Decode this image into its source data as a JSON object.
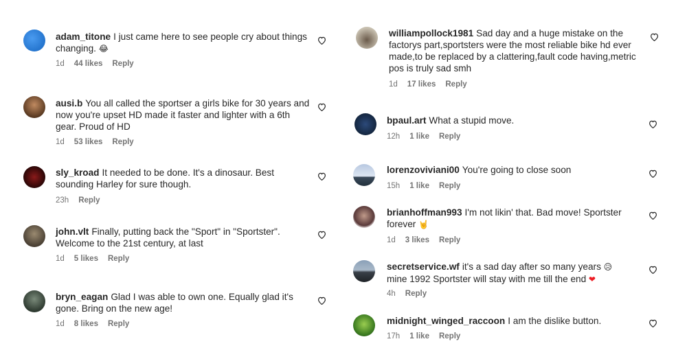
{
  "comments_left": [
    {
      "user": "adam_titone",
      "text": "I just came here to see people cry about things changing.",
      "emoji": "😂",
      "time": "1d",
      "likes": "44 likes",
      "reply": "Reply"
    },
    {
      "user": "ausi.b",
      "text": "You all called the sportser a girls bike for 30 years and now you're upset HD made it faster and lighter with a 6th gear. Proud of HD",
      "time": "1d",
      "likes": "53 likes",
      "reply": "Reply"
    },
    {
      "user": "sly_kroad",
      "text": "It needed to be done. It's a dinosaur. Best sounding Harley for sure though.",
      "time": "23h",
      "reply": "Reply"
    },
    {
      "user": "john.vlt",
      "text": "Finally, putting back the \"Sport\" in \"Sportster\". Welcome to the 21st century, at last",
      "time": "1d",
      "likes": "5 likes",
      "reply": "Reply"
    },
    {
      "user": "bryn_eagan",
      "text": "Glad I was able to own one. Equally glad it's gone. Bring on the new age!",
      "time": "1d",
      "likes": "8 likes",
      "reply": "Reply"
    }
  ],
  "comments_right": [
    {
      "user": "williampollock1981",
      "text": "Sad day and a huge mistake on the factorys part,sportsters were the most reliable bike hd ever made,to be replaced by a clattering,fault code having,metric pos is truly sad smh",
      "time": "1d",
      "likes": "17 likes",
      "reply": "Reply"
    },
    {
      "user": "bpaul.art",
      "text": "What a stupid move.",
      "time": "12h",
      "likes": "1 like",
      "reply": "Reply"
    },
    {
      "user": "lorenzoviviani00",
      "text": "You're going to close soon",
      "time": "15h",
      "likes": "1 like",
      "reply": "Reply"
    },
    {
      "user": "brianhoffman993",
      "text": "I'm not likin' that. Bad move! Sportster forever",
      "emoji": "🤘",
      "time": "1d",
      "likes": "3 likes",
      "reply": "Reply"
    },
    {
      "user": "secretservice.wf",
      "text": "it's a sad day after so many years",
      "emoji": "😥",
      "text2": "mine 1992 Sportster will stay with me till the end",
      "emoji2": "❤",
      "time": "4h",
      "reply": "Reply"
    },
    {
      "user": "midnight_winged_raccoon",
      "text": "I am the dislike button.",
      "time": "17h",
      "likes": "1 like",
      "reply": "Reply"
    }
  ],
  "icons": {
    "heart": "heart-icon"
  },
  "colors": {
    "text": "#262626",
    "meta": "#737373",
    "heart_red": "#ed1c24"
  }
}
